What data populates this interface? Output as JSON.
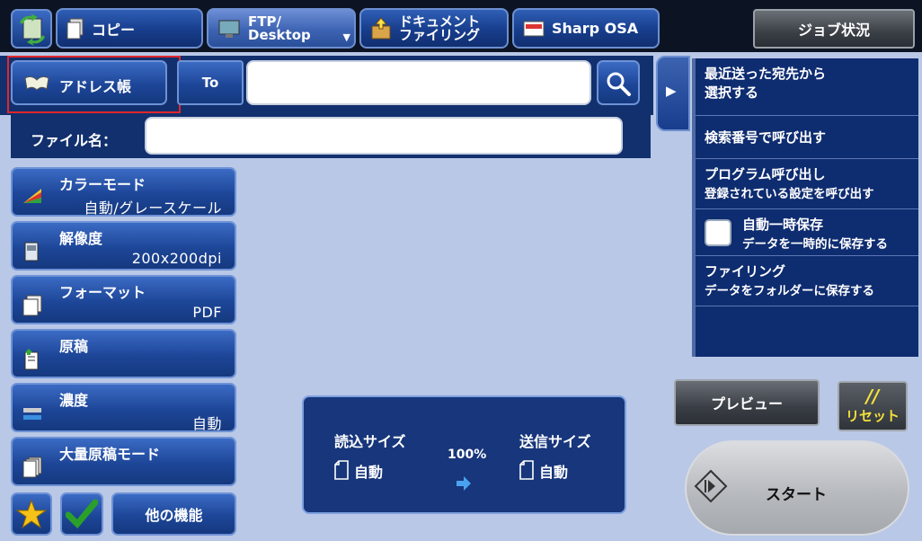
{
  "tabs": [
    {
      "label": "コピー"
    },
    {
      "label_line1": "FTP/",
      "label_line2": "Desktop"
    },
    {
      "label_line1": "ドキュメント",
      "label_line2": "ファイリング"
    },
    {
      "label": "Sharp OSA"
    }
  ],
  "job_status_label": "ジョブ状況",
  "address_book_label": "アドレス帳",
  "to_label": "To",
  "to_value": "",
  "filename_label": "ファイル名：",
  "filename_value": "",
  "functions": [
    {
      "label": "カラーモード",
      "value": "自動/グレースケール"
    },
    {
      "label": "解像度",
      "value": "200x200dpi"
    },
    {
      "label": "フォーマット",
      "value": "PDF"
    },
    {
      "label": "原稿",
      "value": ""
    },
    {
      "label": "濃度",
      "value": "自動"
    },
    {
      "label": "大量原稿モード",
      "value": ""
    }
  ],
  "other_functions_label": "他の機能",
  "right_menu": {
    "recent_line1": "最近送った宛先から",
    "recent_line2": "選択する",
    "search_number": "検索番号で呼び出す",
    "program_title": "プログラム呼び出し",
    "program_sub": "登録されている設定を呼び出す",
    "auto_save_title": "自動一時保存",
    "auto_save_sub": "データを一時的に保存する",
    "filing_title": "ファイリング",
    "filing_sub": "データをフォルダーに保存する"
  },
  "scan_info": {
    "read_size_label": "読込サイズ",
    "read_size_value": "自動",
    "ratio": "100%",
    "send_size_label": "送信サイズ",
    "send_size_value": "自動"
  },
  "preview_label": "プレビュー",
  "reset_label": "リセット",
  "reset_mark": "//",
  "start_label": "スタート",
  "colors": {
    "accent": "#1d4698",
    "highlight": "#e0262b",
    "reset_yellow": "#f3e23a"
  }
}
